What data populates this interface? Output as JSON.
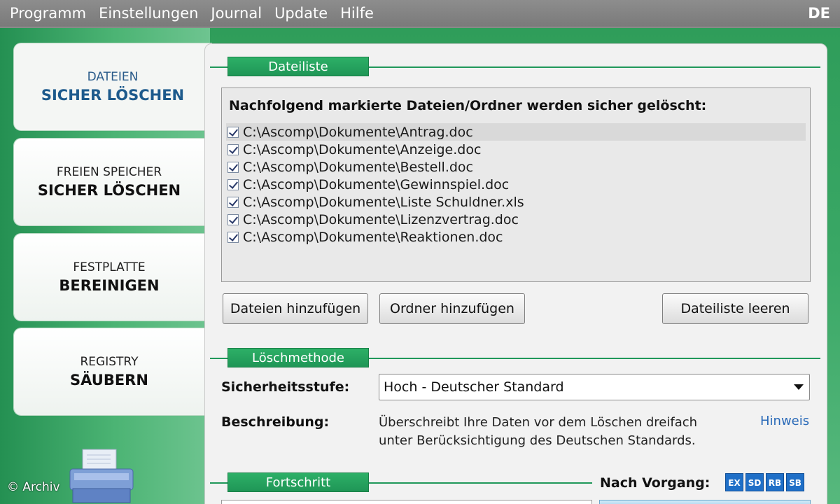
{
  "menu": {
    "items": [
      "Programm",
      "Einstellungen",
      "Journal",
      "Update",
      "Hilfe"
    ],
    "language": "DE"
  },
  "sidebar": {
    "tabs": [
      {
        "line1": "DATEIEN",
        "line2": "SICHER LÖSCHEN",
        "active": true
      },
      {
        "line1": "FREIEN SPEICHER",
        "line2": "SICHER LÖSCHEN",
        "active": false
      },
      {
        "line1": "FESTPLATTE",
        "line2": "BEREINIGEN",
        "active": false
      },
      {
        "line1": "REGISTRY",
        "line2": "SÄUBERN",
        "active": false
      }
    ],
    "printer_icon": "printer-shredder-icon"
  },
  "watermark": "© Archiv",
  "filelist": {
    "section_label": "Dateiliste",
    "heading": "Nachfolgend markierte Dateien/Ordner werden sicher gelöscht:",
    "files": [
      {
        "path": "C:\\Ascomp\\Dokumente\\Antrag.doc",
        "checked": true
      },
      {
        "path": "C:\\Ascomp\\Dokumente\\Anzeige.doc",
        "checked": true
      },
      {
        "path": "C:\\Ascomp\\Dokumente\\Bestell.doc",
        "checked": true
      },
      {
        "path": "C:\\Ascomp\\Dokumente\\Gewinnspiel.doc",
        "checked": true
      },
      {
        "path": "C:\\Ascomp\\Dokumente\\Liste Schuldner.xls",
        "checked": true
      },
      {
        "path": "C:\\Ascomp\\Dokumente\\Lizenzvertrag.doc",
        "checked": true
      },
      {
        "path": "C:\\Ascomp\\Dokumente\\Reaktionen.doc",
        "checked": true
      }
    ],
    "buttons": {
      "add_files": "Dateien hinzufügen",
      "add_folder": "Ordner hinzufügen",
      "clear_list": "Dateiliste leeren"
    }
  },
  "method": {
    "section_label": "Löschmethode",
    "security_label": "Sicherheitsstufe:",
    "security_value": "Hoch - Deutscher Standard",
    "description_label": "Beschreibung:",
    "description_line1": "Überschreibt Ihre Daten vor dem Löschen dreifach",
    "description_line2": "unter Berücksichtigung des Deutschen Standards.",
    "hint_link": "Hinweis"
  },
  "progress": {
    "section_label": "Fortschritt",
    "after_label": "Nach Vorgang:",
    "badges": [
      "EX",
      "SD",
      "RB",
      "SB"
    ]
  },
  "colors": {
    "accent_green": "#1f9656",
    "badge_blue": "#1f6fc7",
    "link_blue": "#2a6ab8"
  }
}
